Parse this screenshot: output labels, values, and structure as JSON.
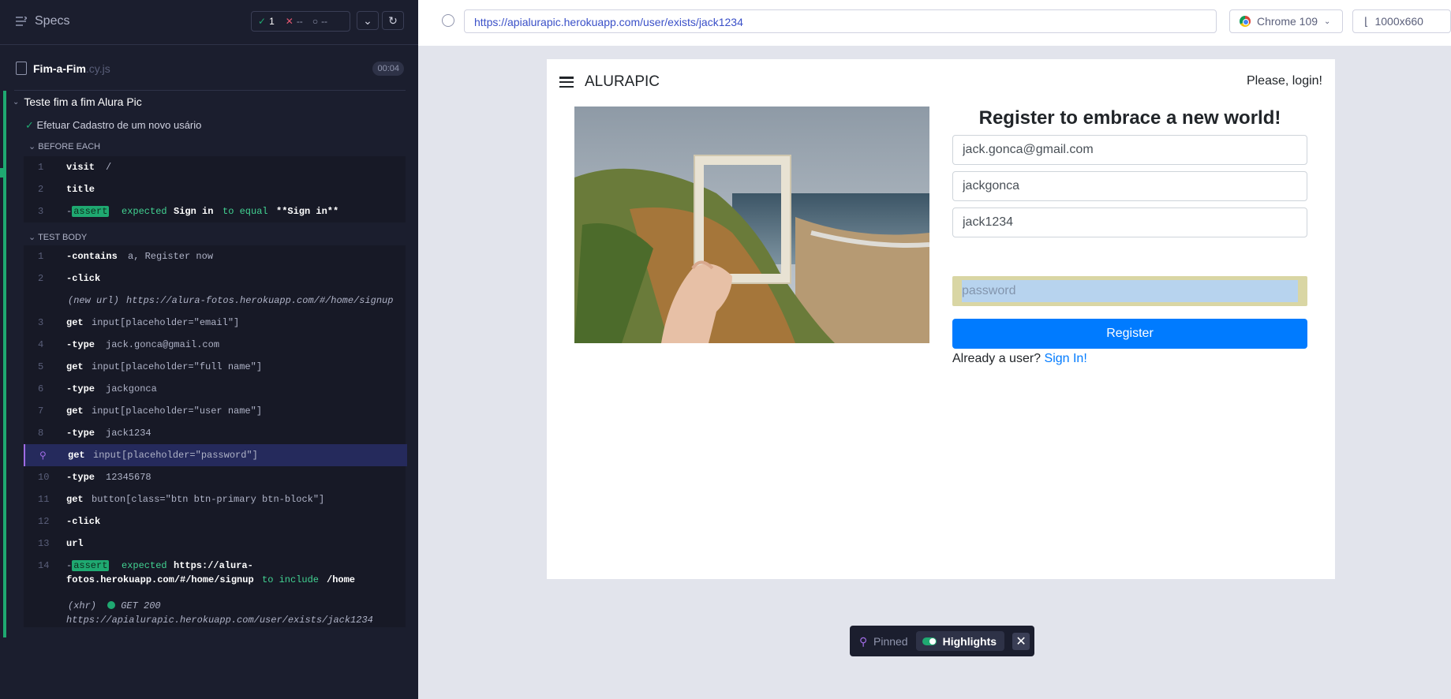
{
  "sidebar": {
    "specs_label": "Specs",
    "stats": {
      "passed": "1",
      "failed": "--",
      "pending": "--"
    },
    "file": {
      "name": "Fim-a-Fim",
      "ext": ".cy.js",
      "duration": "00:04"
    },
    "suite_title": "Teste fim a fim Alura Pic",
    "test_title": "Efetuar Cadastro de um novo usário",
    "before_each_label": "BEFORE EACH",
    "test_body_label": "TEST BODY",
    "before_each": [
      {
        "num": "1",
        "name": "visit",
        "msg": "/"
      },
      {
        "num": "2",
        "name": "title",
        "msg": ""
      },
      {
        "num": "3",
        "prefix": "-",
        "badge": "assert",
        "parts": [
          "expected",
          "Sign in",
          "to equal",
          "**Sign in**"
        ]
      }
    ],
    "body": [
      {
        "num": "1",
        "name": "-contains",
        "msg": "a, Register now"
      },
      {
        "num": "2",
        "name": "-click",
        "msg": ""
      },
      {
        "num": "",
        "event": "(new url)",
        "msg": "https://alura-fotos.herokuapp.com/#/home/signup"
      },
      {
        "num": "3",
        "name": "get",
        "msg": "input[placeholder=\"email\"]"
      },
      {
        "num": "4",
        "name": "-type",
        "msg": "jack.gonca@gmail.com"
      },
      {
        "num": "5",
        "name": "get",
        "msg": "input[placeholder=\"full name\"]"
      },
      {
        "num": "6",
        "name": "-type",
        "msg": "jackgonca"
      },
      {
        "num": "7",
        "name": "get",
        "msg": "input[placeholder=\"user name\"]"
      },
      {
        "num": "8",
        "name": "-type",
        "msg": "jack1234"
      },
      {
        "num": "9",
        "name": "get",
        "msg": "input[placeholder=\"password\"]"
      },
      {
        "num": "10",
        "name": "-type",
        "msg": "12345678"
      },
      {
        "num": "11",
        "name": "get",
        "msg": "button[class=\"btn btn-primary btn-block\"]"
      },
      {
        "num": "12",
        "name": "-click",
        "msg": ""
      },
      {
        "num": "13",
        "name": "url",
        "msg": ""
      },
      {
        "num": "14",
        "prefix": "-",
        "badge": "assert",
        "parts": [
          "expected",
          "https://alura-",
          "fotos.herokuapp.com/#/home/signup",
          "to include",
          "/home"
        ]
      }
    ],
    "xhr": {
      "event": "(xhr)",
      "status": "GET 200",
      "url": "https://apialurapic.herokuapp.com/user/exists/jack1234"
    }
  },
  "aut": {
    "url": "https://apialurapic.herokuapp.com/user/exists/jack1234",
    "browser": "Chrome 109",
    "viewport": "1000x660"
  },
  "app": {
    "brand": "ALURAPIC",
    "login_link": "Please, login!",
    "form_title": "Register to embrace a new world!",
    "email_value": "jack.gonca@gmail.com",
    "fullname_value": "jackgonca",
    "username_value": "jack1234",
    "password_placeholder": "password",
    "register_label": "Register",
    "already_text": "Already a user?",
    "signin_link": "Sign In!"
  },
  "pinned_bar": {
    "pinned_label": "Pinned",
    "highlights_label": "Highlights"
  },
  "colors": {
    "pass": "#1fa971",
    "fail": "#e45770",
    "pinned": "#a06ce4",
    "primary": "#007bff"
  }
}
